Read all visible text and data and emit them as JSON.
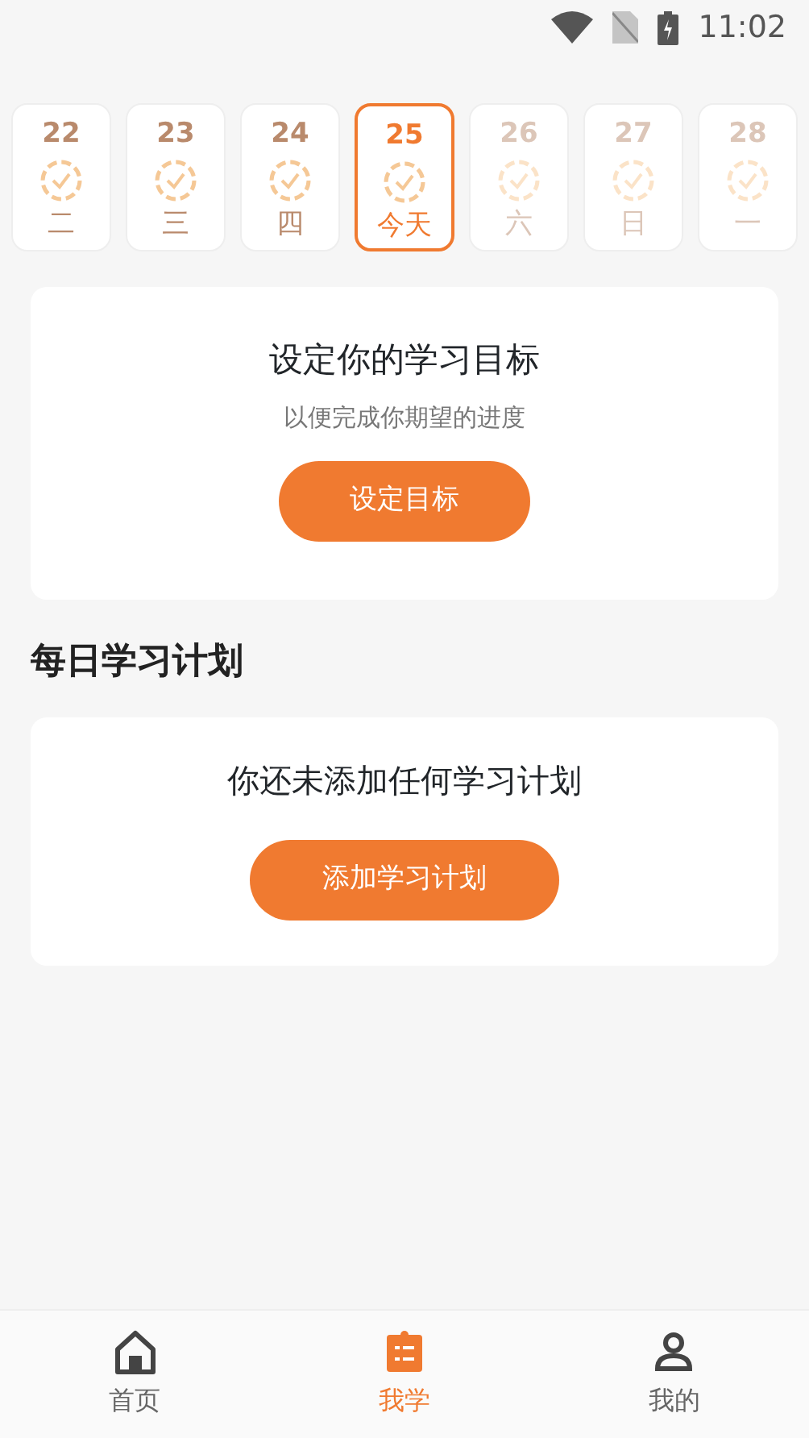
{
  "status_bar": {
    "time": "11:02"
  },
  "days": [
    {
      "date": "22",
      "weekday": "二",
      "kind": "past",
      "selected": false
    },
    {
      "date": "23",
      "weekday": "三",
      "kind": "past",
      "selected": false
    },
    {
      "date": "24",
      "weekday": "四",
      "kind": "past",
      "selected": false
    },
    {
      "date": "25",
      "weekday": "今天",
      "kind": "today",
      "selected": true
    },
    {
      "date": "26",
      "weekday": "六",
      "kind": "future",
      "selected": false
    },
    {
      "date": "27",
      "weekday": "日",
      "kind": "future",
      "selected": false
    },
    {
      "date": "28",
      "weekday": "一",
      "kind": "future",
      "selected": false
    }
  ],
  "goal_card": {
    "title": "设定你的学习目标",
    "subtitle": "以便完成你期望的进度",
    "button": "设定目标"
  },
  "plan_section": {
    "heading": "每日学习计划",
    "empty_text": "你还未添加任何学习计划",
    "button": "添加学习计划"
  },
  "bottom_nav": [
    {
      "label": "首页",
      "selected": false
    },
    {
      "label": "我学",
      "selected": true
    },
    {
      "label": "我的",
      "selected": false
    }
  ]
}
